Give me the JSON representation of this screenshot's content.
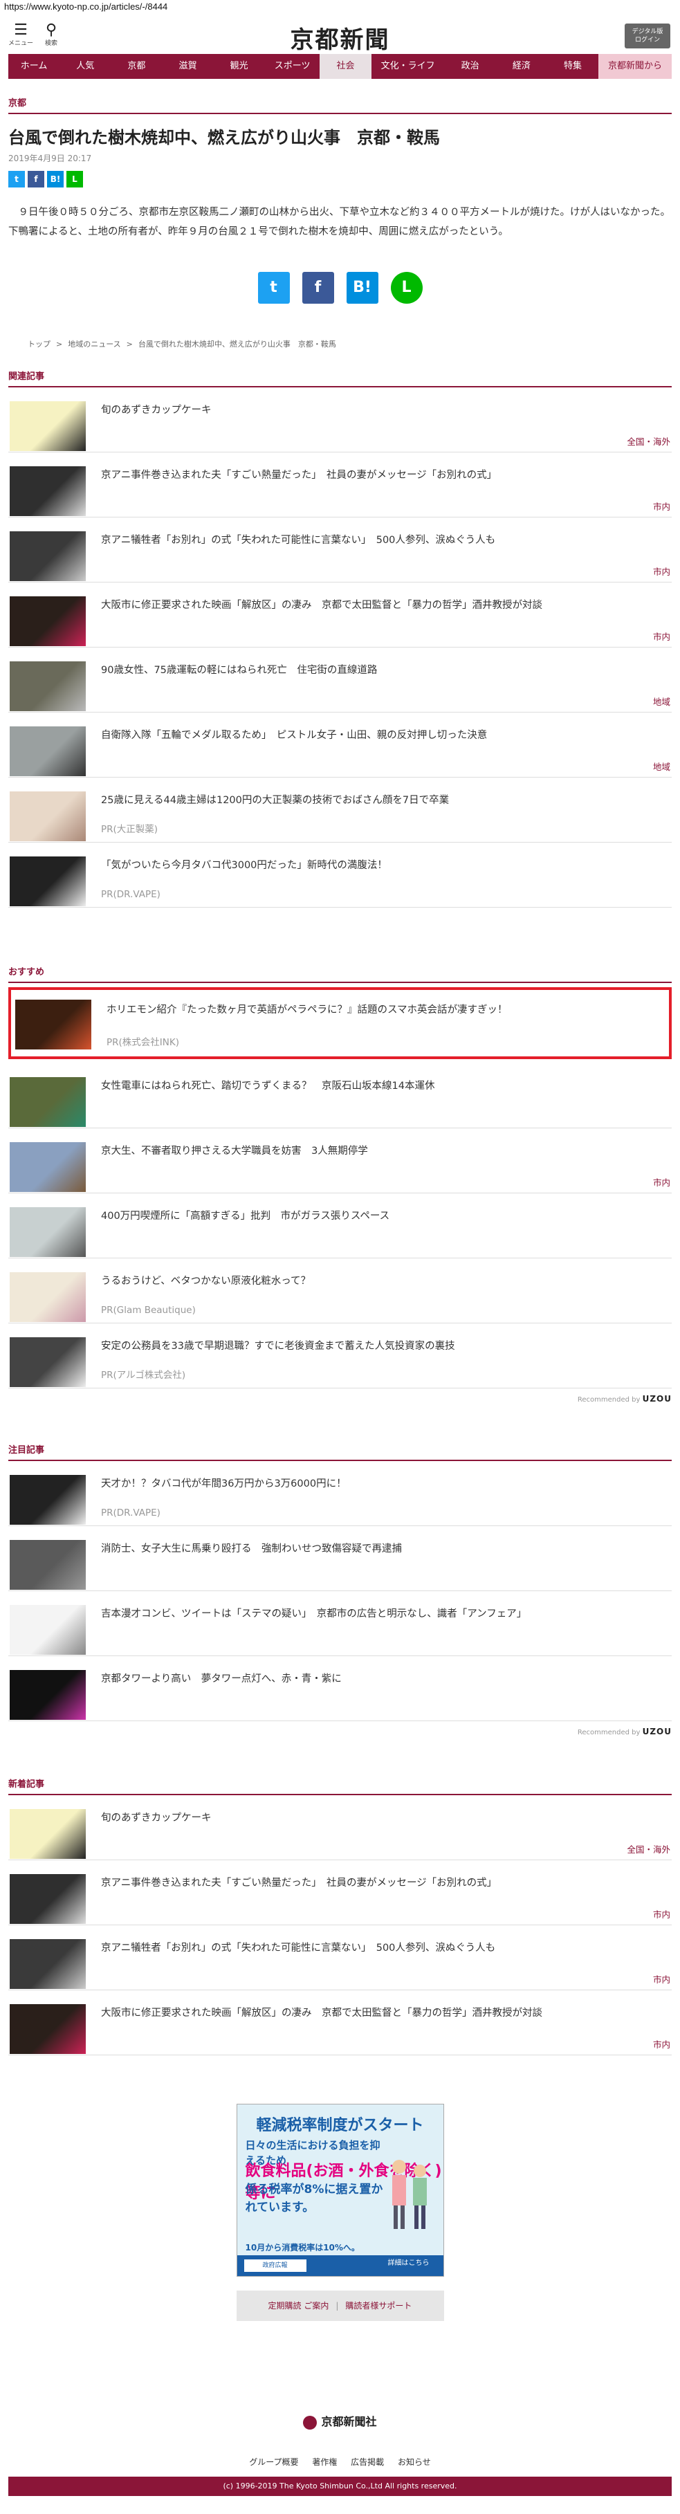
{
  "url": "https://www.kyoto-np.co.jp/articles/-/8444",
  "header": {
    "menu_label": "メニュー",
    "search_label": "検索",
    "logo": "京都新聞",
    "digital_line1": "デジタル版",
    "digital_line2": "ログイン"
  },
  "nav": [
    "ホーム",
    "人気",
    "京都",
    "滋賀",
    "観光",
    "スポーツ",
    "社会",
    "文化・ライフ",
    "政治",
    "経済",
    "特集",
    "京都新聞から"
  ],
  "article": {
    "section": "京都",
    "title": "台風で倒れた樹木焼却中、燃え広がり山火事　京都・鞍馬",
    "date": "2019年4月9日 20:17",
    "body": "９日午後０時５０分ごろ、京都市左京区鞍馬二ノ瀬町の山林から出火、下草や立木など約３４００平方メートルが焼けた。けが人はいなかった。下鴨署によると、土地の所有者が、昨年９月の台風２１号で倒れた樹木を焼却中、周囲に燃え広がったという。"
  },
  "share": {
    "tw": "t",
    "fb": "f",
    "hb": "B!",
    "ln": "L"
  },
  "breadcrumb": [
    "トップ",
    "地域のニュース",
    "台風で倒れた樹木焼却中、燃え広がり山火事　京都・鞍馬"
  ],
  "sep": ">",
  "related": {
    "label": "関連記事",
    "items": [
      {
        "title": "旬のあずきカップケーキ",
        "cat": "全国・海外",
        "pr": ""
      },
      {
        "title": "京アニ事件巻き込まれた夫「すごい熱量だった」　社員の妻がメッセージ「お別れの式」",
        "cat": "市内",
        "pr": ""
      },
      {
        "title": "京アニ犠牲者「お別れ」の式「失われた可能性に言葉ない」　500人参列、涙ぬぐう人も",
        "cat": "市内",
        "pr": ""
      },
      {
        "title": "大阪市に修正要求された映画「解放区」の凄み　京都で太田監督と「暴力の哲学」酒井教授が対談",
        "cat": "市内",
        "pr": ""
      },
      {
        "title": "90歳女性、75歳運転の軽にはねられ死亡　住宅街の直線道路",
        "cat": "地域",
        "pr": ""
      },
      {
        "title": "自衛隊入隊「五輪でメダル取るため」　ピストル女子・山田、親の反対押し切った決意",
        "cat": "地域",
        "pr": ""
      },
      {
        "title": "25歳に見える44歳主婦は1200円の大正製薬の技術でおばさん顔を7日で卒業",
        "cat": "",
        "pr": "PR(大正製薬)"
      },
      {
        "title": "「気がついたら今月タバコ代3000円だった」新時代の満腹法！",
        "cat": "",
        "pr": "PR(DR.VAPE)"
      }
    ]
  },
  "recommend": {
    "label": "おすすめ",
    "items": [
      {
        "title": "ホリエモン紹介『たった数ヶ月で英語がペラペラに？』話題のスマホ英会話が凄すぎッ！",
        "cat": "",
        "pr": "PR(株式会社INK)"
      },
      {
        "title": "女性電車にはねられ死亡、踏切でうずくまる？　京阪石山坂本線14本運休",
        "cat": "",
        "pr": ""
      },
      {
        "title": "京大生、不審者取り押さえる大学職員を妨害　3人無期停学",
        "cat": "市内",
        "pr": ""
      },
      {
        "title": "400万円喫煙所に「高額すぎる」批判　市がガラス張りスペース",
        "cat": "",
        "pr": ""
      },
      {
        "title": "うるおうけど、ベタつかない原液化粧水って？",
        "cat": "",
        "pr": "PR(Glam Beautique)"
      },
      {
        "title": "安定の公務員を33歳で早期退職？すでに老後資金まで蓄えた人気投資家の裏技",
        "cat": "",
        "pr": "PR(アルゴ株式会社)"
      }
    ],
    "recby": "Recommended by",
    "recby_brand": "UZOU"
  },
  "featured": {
    "label": "注目記事",
    "items": [
      {
        "title": "天才か！？タバコ代が年間36万円から3万6000円に！",
        "cat": "",
        "pr": "PR(DR.VAPE)"
      },
      {
        "title": "消防士、女子大生に馬乗り殴打る　強制わいせつ致傷容疑で再逮捕",
        "cat": "",
        "pr": ""
      },
      {
        "title": "吉本漫才コンビ、ツイートは「ステマの疑い」　京都市の広告と明示なし、識者「アンフェア」",
        "cat": "",
        "pr": ""
      },
      {
        "title": "京都タワーより高い　夢タワー点灯へ、赤・青・紫に",
        "cat": "",
        "pr": ""
      }
    ],
    "recby": "Recommended by",
    "recby_brand": "UZOU"
  },
  "latest": {
    "label": "新着記事",
    "items": [
      {
        "title": "旬のあずきカップケーキ",
        "cat": "全国・海外",
        "pr": ""
      },
      {
        "title": "京アニ事件巻き込まれた夫「すごい熱量だった」　社員の妻がメッセージ「お別れの式」",
        "cat": "市内",
        "pr": ""
      },
      {
        "title": "京アニ犠牲者「お別れ」の式「失われた可能性に言葉ない」　500人参列、涙ぬぐう人も",
        "cat": "市内",
        "pr": ""
      },
      {
        "title": "大阪市に修正要求された映画「解放区」の凄み　京都で太田監督と「暴力の哲学」酒井教授が対談",
        "cat": "市内",
        "pr": ""
      }
    ]
  },
  "ad": {
    "line1": "軽減税率制度がスタート",
    "line2": "日々の生活における負担を抑えるため",
    "line3": "飲食料品(お酒・外食を除く)等に",
    "line4": "係る税率が8%に据え置かれています。",
    "line5": "10月から消費税率は10%へ。",
    "seal": "政府広報",
    "more": "詳細はこちら"
  },
  "subscribe": {
    "a": "定期購読 ご案内",
    "sep": "|",
    "b": "購読者様サポート"
  },
  "footer": {
    "logo": "京都新聞社",
    "links": [
      "グループ概要",
      "著作権",
      "広告掲載",
      "お知らせ"
    ],
    "copyright": "(c) 1996-2019 The Kyoto Shimbun Co.,Ltd All rights reserved."
  },
  "colors": {
    "brand": "#8b1538",
    "highlight": "#e41e2a"
  }
}
